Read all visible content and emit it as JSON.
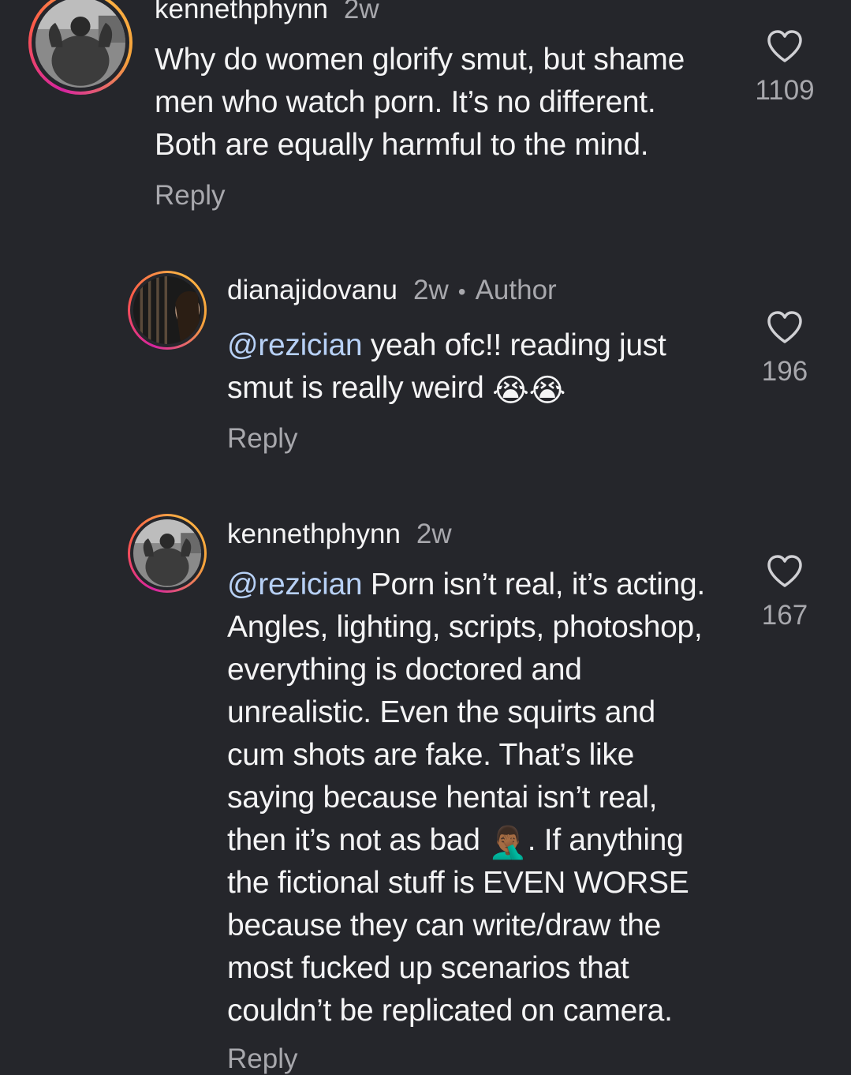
{
  "comments": [
    {
      "username": "kennethphynn",
      "time": "2w",
      "lines": [
        "Why do women glorify smut, but shame",
        "men who watch porn. It’s no different.",
        "Both are equally harmful to the mind."
      ],
      "reply_label": "Reply",
      "likes": "1109",
      "avatar_icon": "bodybuilder-photo"
    },
    {
      "username": "dianajidovanu",
      "time": "2w",
      "separator": "•",
      "author_badge": "Author",
      "mention": "@rezician",
      "line1_rest": " yeah ofc!! reading just",
      "line2": "smut is really weird ",
      "emoji": "😭😭",
      "reply_label": "Reply",
      "likes": "196",
      "avatar_icon": "dark-portrait-photo"
    },
    {
      "username": "kennethphynn",
      "time": "2w",
      "mention": "@rezician",
      "line1_rest": " Porn isn’t real, it’s acting.",
      "lines": [
        "Angles, lighting, scripts, photoshop,",
        "everything is doctored and",
        "unrealistic. Even the squirts and",
        "cum shots are fake. That’s like",
        "saying because hentai isn’t real,"
      ],
      "line_emoji_before": "then it’s not as bad ",
      "emoji": "🤦🏾‍♂️",
      "line_emoji_after": ". If anything",
      "lines_after": [
        "the fictional stuff is EVEN WORSE",
        "because they can write/draw the",
        "most fucked up scenarios that",
        "couldn’t be replicated on camera."
      ],
      "reply_label": "Reply",
      "likes": "167",
      "avatar_icon": "bodybuilder-photo"
    }
  ],
  "colors": {
    "background": "#25262b",
    "text": "#f4f4f5",
    "secondary": "#a8a8ad",
    "mention": "#b7d0f5"
  }
}
